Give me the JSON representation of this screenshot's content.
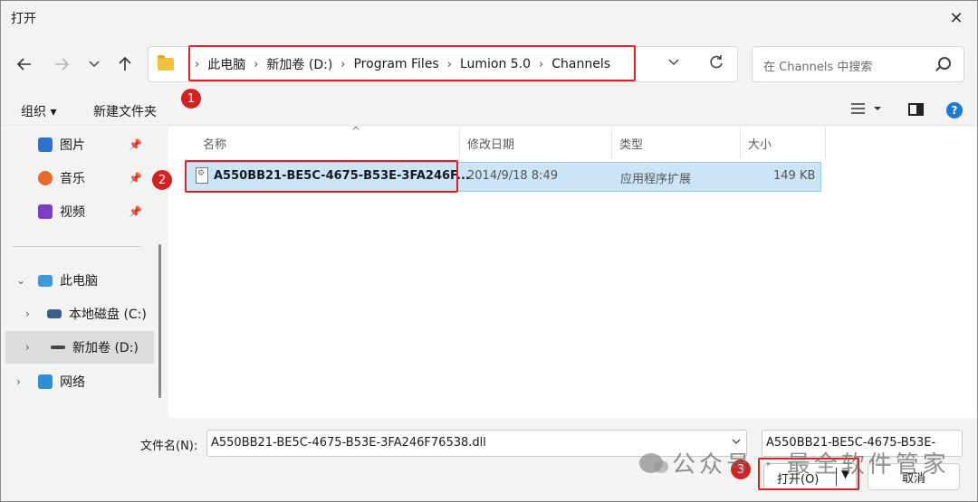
{
  "window": {
    "title": "打开",
    "close_glyph": "✕"
  },
  "nav": {
    "breadcrumbs": [
      "此电脑",
      "新加卷 (D:)",
      "Program Files",
      "Lumion 5.0",
      "Channels"
    ],
    "separator": "›"
  },
  "search": {
    "placeholder": "在 Channels 中搜索"
  },
  "toolbar": {
    "organize_label": "组织 ▾",
    "new_folder_label": "新建文件夹",
    "help_glyph": "?"
  },
  "sidebar": {
    "pinned": [
      {
        "label": "图片",
        "icon": "pictures-icon",
        "color": "#2f6fd0"
      },
      {
        "label": "音乐",
        "icon": "music-icon",
        "color": "#e86a2a"
      },
      {
        "label": "视频",
        "icon": "video-icon",
        "color": "#7a3fc4"
      }
    ],
    "tree": [
      {
        "label": "此电脑",
        "icon": "computer-icon",
        "color": "#3b9ad9"
      },
      {
        "label": "本地磁盘 (C:)",
        "icon": "drive-c-icon",
        "color": "#3a5f8a"
      },
      {
        "label": "新加卷 (D:)",
        "icon": "drive-d-icon",
        "color": "#444444"
      },
      {
        "label": "网络",
        "icon": "network-icon",
        "color": "#2f8fd6"
      }
    ]
  },
  "columns": {
    "name": "名称",
    "modified": "修改日期",
    "type": "类型",
    "size": "大小"
  },
  "files": [
    {
      "name": "A550BB21-BE5C-4675-B53E-3FA246F...",
      "modified": "2014/9/18 8:49",
      "type": "应用程序扩展",
      "size": "149 KB"
    }
  ],
  "footer": {
    "filename_label": "文件名(N):",
    "filename_value": "A550BB21-BE5C-4675-B53E-3FA246F76538.dll",
    "filter_value": "A550BB21-BE5C-4675-B53E-",
    "open_label": "打开(O)",
    "cancel_label": "取消"
  },
  "annotations": {
    "step1": "1",
    "step2": "2",
    "step3": "3",
    "highlight_color": "#e02020"
  },
  "watermark": {
    "text": "公众号 · 最全软件管家"
  }
}
